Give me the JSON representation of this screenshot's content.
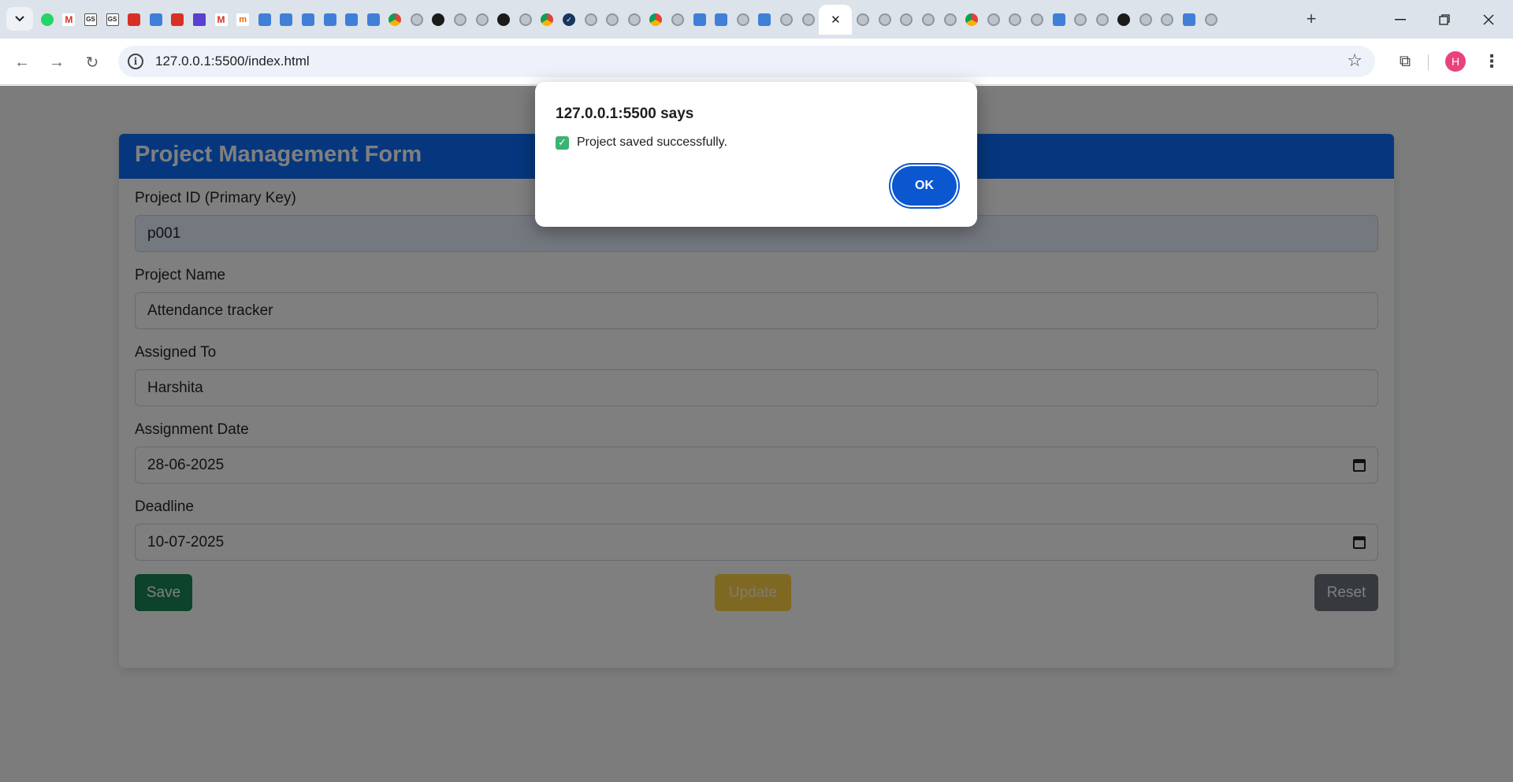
{
  "browser": {
    "tabs": [
      {
        "icon": "whatsapp-icon",
        "style": "green",
        "glyph": ""
      },
      {
        "icon": "gmail-icon",
        "style": "gm",
        "glyph": "M"
      },
      {
        "icon": "gs-icon",
        "style": "gs",
        "glyph": "GS"
      },
      {
        "icon": "gs-icon",
        "style": "gs",
        "glyph": "GS"
      },
      {
        "icon": "red-app-icon",
        "style": "red",
        "glyph": ""
      },
      {
        "icon": "avatar-app-icon",
        "style": "blue",
        "glyph": ""
      },
      {
        "icon": "santa-app-icon",
        "style": "red",
        "glyph": ""
      },
      {
        "icon": "list-app-icon",
        "style": "purple",
        "glyph": ""
      },
      {
        "icon": "gmail-icon",
        "style": "gm",
        "glyph": "M"
      },
      {
        "icon": "moodle-icon",
        "style": "orange",
        "glyph": "m"
      },
      {
        "icon": "blue-app-icon",
        "style": "blue",
        "glyph": ""
      },
      {
        "icon": "blue-app-icon",
        "style": "blue",
        "glyph": ""
      },
      {
        "icon": "blue-app-icon",
        "style": "blue",
        "glyph": ""
      },
      {
        "icon": "blue-app-icon",
        "style": "blue",
        "glyph": ""
      },
      {
        "icon": "blue-app-icon",
        "style": "blue",
        "glyph": ""
      },
      {
        "icon": "blue-app-icon",
        "style": "blue",
        "glyph": ""
      },
      {
        "icon": "chrome-icon",
        "style": "chrome",
        "glyph": ""
      },
      {
        "icon": "openai-icon",
        "style": "globe",
        "glyph": ""
      },
      {
        "icon": "openai-icon",
        "style": "dark",
        "glyph": ""
      },
      {
        "icon": "globe-icon",
        "style": "globe",
        "glyph": ""
      },
      {
        "icon": "globe-icon",
        "style": "globe",
        "glyph": ""
      },
      {
        "icon": "github-icon",
        "style": "dark",
        "glyph": ""
      },
      {
        "icon": "globe-icon",
        "style": "globe",
        "glyph": ""
      },
      {
        "icon": "chrome-icon",
        "style": "chrome",
        "glyph": ""
      },
      {
        "icon": "check-app-icon",
        "style": "chk",
        "glyph": "✓"
      },
      {
        "icon": "globe-icon",
        "style": "globe",
        "glyph": ""
      },
      {
        "icon": "globe-icon",
        "style": "globe",
        "glyph": ""
      },
      {
        "icon": "globe-icon",
        "style": "globe",
        "glyph": ""
      },
      {
        "icon": "chrome-icon",
        "style": "chrome",
        "glyph": ""
      },
      {
        "icon": "globe-icon",
        "style": "globe",
        "glyph": ""
      },
      {
        "icon": "blue-app-icon",
        "style": "blue",
        "glyph": ""
      },
      {
        "icon": "blue-app-icon",
        "style": "blue",
        "glyph": ""
      },
      {
        "icon": "globe-icon",
        "style": "globe",
        "glyph": ""
      },
      {
        "icon": "blue-app-icon",
        "style": "blue",
        "glyph": ""
      },
      {
        "icon": "globe-icon",
        "style": "globe",
        "glyph": ""
      },
      {
        "icon": "globe-icon",
        "style": "globe",
        "glyph": ""
      },
      {
        "icon": "close-icon",
        "style": "active",
        "glyph": "✕"
      },
      {
        "icon": "globe-icon",
        "style": "globe",
        "glyph": ""
      },
      {
        "icon": "globe-icon",
        "style": "globe",
        "glyph": ""
      },
      {
        "icon": "globe-icon",
        "style": "globe",
        "glyph": ""
      },
      {
        "icon": "globe-icon",
        "style": "globe",
        "glyph": ""
      },
      {
        "icon": "globe-icon",
        "style": "globe",
        "glyph": ""
      },
      {
        "icon": "chrome-icon",
        "style": "chrome",
        "glyph": ""
      },
      {
        "icon": "globe-icon",
        "style": "globe",
        "glyph": ""
      },
      {
        "icon": "globe-icon",
        "style": "globe",
        "glyph": ""
      },
      {
        "icon": "globe-icon",
        "style": "globe",
        "glyph": ""
      },
      {
        "icon": "blue-app-icon",
        "style": "blue",
        "glyph": ""
      },
      {
        "icon": "globe-icon",
        "style": "globe",
        "glyph": ""
      },
      {
        "icon": "globe-icon",
        "style": "globe",
        "glyph": ""
      },
      {
        "icon": "github-icon",
        "style": "dark",
        "glyph": ""
      },
      {
        "icon": "globe-icon",
        "style": "globe",
        "glyph": ""
      },
      {
        "icon": "globe-icon",
        "style": "globe",
        "glyph": ""
      },
      {
        "icon": "blue-app-icon",
        "style": "blue",
        "glyph": ""
      },
      {
        "icon": "globe-icon",
        "style": "globe",
        "glyph": ""
      }
    ],
    "url": "127.0.0.1:5500/index.html",
    "profile_initial": "H"
  },
  "form": {
    "title": "Project Management Form",
    "fields": {
      "project_id": {
        "label": "Project ID (Primary Key)",
        "value": "p001"
      },
      "project_name": {
        "label": "Project Name",
        "value": "Attendance tracker"
      },
      "assigned_to": {
        "label": "Assigned To",
        "value": "Harshita"
      },
      "assignment_date": {
        "label": "Assignment Date",
        "value": "28-06-2025"
      },
      "deadline": {
        "label": "Deadline",
        "value": "10-07-2025"
      }
    },
    "buttons": {
      "save": "Save",
      "update": "Update",
      "reset": "Reset"
    },
    "colors": {
      "header": "#0d6efd",
      "save": "#198754",
      "update": "#ffc107",
      "reset": "#6c757d"
    }
  },
  "dialog": {
    "title": "127.0.0.1:5500 says",
    "message": "Project saved successfully.",
    "ok_label": "OK"
  }
}
